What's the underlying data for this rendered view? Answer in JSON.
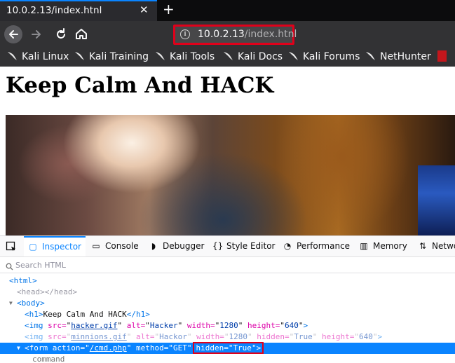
{
  "browser": {
    "tab_title": "10.0.2.13/index.htnl",
    "url_host": "10.0.2.13",
    "url_path": "/index.htnl",
    "accent_color": "#0a84ff",
    "highlight_color": "#e0001a",
    "bookmarks": [
      "Kali Linux",
      "Kali Training",
      "Kali Tools",
      "Kali Docs",
      "Kali Forums",
      "NetHunter"
    ]
  },
  "page": {
    "heading": "Keep Calm And HACK"
  },
  "devtools": {
    "tabs": [
      "Inspector",
      "Console",
      "Debugger",
      "Style Editor",
      "Performance",
      "Memory",
      "Netwo"
    ],
    "active_tab": "Inspector",
    "search_placeholder": "Search HTML",
    "tree": {
      "html_open": "<html>",
      "head": "<head></head>",
      "body_open": "<body>",
      "h1_open": "<h1>",
      "h1_text": "Keep Calm And HACK",
      "h1_close": "</h1>",
      "img1": {
        "open": "<img",
        "src_attr": "src=",
        "src": "hacker.gif",
        "alt_attr": "alt=",
        "alt": "Hacker",
        "width_attr": "width=",
        "width": "1280",
        "height_attr": "height=",
        "height": "640",
        "close": ">"
      },
      "img2": {
        "open": "<img",
        "src_attr": "src=",
        "src": "minnions.gif",
        "alt_attr": "alt=",
        "alt": "Hackor",
        "width_attr": "width=",
        "width": "1280",
        "hidden_attr": "hidden=",
        "hidden": "True",
        "height_attr": "height=",
        "height": "640",
        "close": ">"
      },
      "form": {
        "open": "<form",
        "action_attr": "action=",
        "action": "/cmd.php",
        "method_attr": "method=",
        "method": "GET",
        "hidden_attr": "hidden=",
        "hidden": "True",
        "close": ">"
      },
      "command_text": "command"
    }
  }
}
